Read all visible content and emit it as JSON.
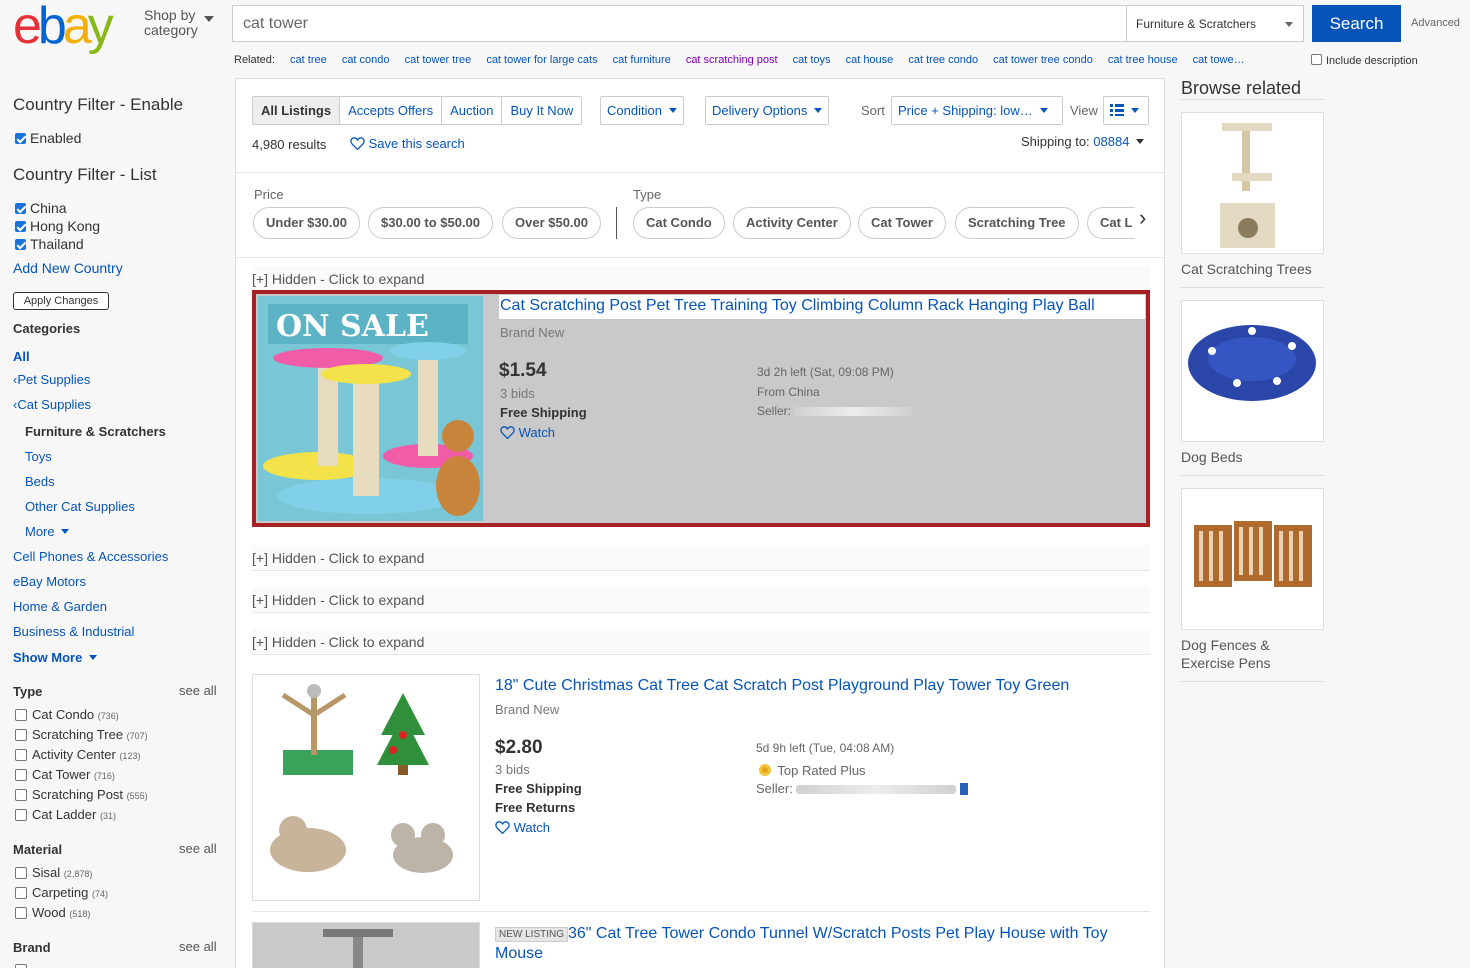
{
  "header": {
    "shop_by": "Shop by",
    "category": "category",
    "query": "cat tower",
    "category_select": "Furniture & Scratchers",
    "search_label": "Search",
    "advanced": "Advanced"
  },
  "related": {
    "label": "Related:",
    "items": [
      {
        "pre": "cat ",
        "bold": "tree"
      },
      {
        "pre": "cat ",
        "bold": "condo"
      },
      {
        "pre": "cat tower ",
        "bold": "tree"
      },
      {
        "pre": "cat tower ",
        "bold": "for large cats"
      },
      {
        "pre": "cat ",
        "bold": "furniture"
      },
      {
        "pre": "cat ",
        "bold": "scratching post"
      },
      {
        "pre": "cat ",
        "bold": "toys"
      },
      {
        "pre": "cat ",
        "bold": "house"
      },
      {
        "pre": "cat ",
        "bold": "tree condo"
      },
      {
        "pre": "cat tower ",
        "bold": "tree condo"
      },
      {
        "pre": "cat ",
        "bold": "tree house"
      },
      {
        "pre": "cat towe",
        "bold": "…"
      }
    ],
    "include_description": "Include description"
  },
  "left": {
    "country_enable_title": "Country Filter - Enable",
    "enabled": "Enabled",
    "country_list_title": "Country Filter - List",
    "countries": [
      "China",
      "Hong Kong",
      "Thailand"
    ],
    "add_country": "Add New Country",
    "apply_changes": "Apply Changes",
    "categories_title": "Categories",
    "all": "All",
    "pet_supplies": "Pet Supplies",
    "cat_supplies": "Cat Supplies",
    "furniture": "Furniture & Scratchers",
    "toys": "Toys",
    "beds": "Beds",
    "other_cat": "Other Cat Supplies",
    "more": "More",
    "cell_phones": "Cell Phones & Accessories",
    "ebay_motors": "eBay Motors",
    "home_garden": "Home & Garden",
    "business": "Business & Industrial",
    "show_more": "Show More",
    "type_title": "Type",
    "see_all": "see all",
    "types": [
      {
        "name": "Cat Condo",
        "count": "(736)"
      },
      {
        "name": "Scratching Tree",
        "count": "(707)"
      },
      {
        "name": "Activity Center",
        "count": "(123)"
      },
      {
        "name": "Cat Tower",
        "count": "(716)"
      },
      {
        "name": "Scratching Post",
        "count": "(555)"
      },
      {
        "name": "Cat Ladder",
        "count": "(31)"
      }
    ],
    "material_title": "Material",
    "materials": [
      {
        "name": "Sisal",
        "count": "(2,878)"
      },
      {
        "name": "Carpeting",
        "count": "(74)"
      },
      {
        "name": "Wood",
        "count": "(518)"
      }
    ],
    "brand_title": "Brand"
  },
  "main": {
    "tabs": [
      "All Listings",
      "Accepts Offers",
      "Auction",
      "Buy It Now"
    ],
    "condition": "Condition",
    "delivery": "Delivery Options",
    "sort_label": "Sort",
    "sort_value": "Price + Shipping: low…",
    "view_label": "View",
    "results": "4,980 results",
    "save_search": "Save this search",
    "shipping_to": "Shipping to:",
    "zip": "08884",
    "price_label": "Price",
    "price_pills": [
      "Under $30.00",
      "$30.00 to $50.00",
      "Over $50.00"
    ],
    "type_label": "Type",
    "type_pills": [
      "Cat Condo",
      "Activity Center",
      "Cat Tower",
      "Scratching Tree",
      "Cat L"
    ],
    "hidden": "[+] Hidden - Click to expand",
    "item1": {
      "badge": "ON SALE",
      "title": "Cat Scratching Post Pet Tree Training Toy Climbing Column Rack Hanging Play Ball",
      "condition": "Brand New",
      "price": "$1.54",
      "bids": "3 bids",
      "shipping": "Free Shipping",
      "watch": "Watch",
      "time_left": "3d 2h left (Sat, 09:08 PM)",
      "from": "From China",
      "seller": "Seller:"
    },
    "item2": {
      "title": "18\" Cute Christmas Cat Tree Cat Scratch Post Playground Play Tower Toy Green",
      "condition": "Brand New",
      "price": "$2.80",
      "bids": "3 bids",
      "shipping": "Free Shipping",
      "returns": "Free Returns",
      "watch": "Watch",
      "time_left": "5d 9h left (Tue, 04:08 AM)",
      "top_rated": "Top Rated Plus",
      "seller": "Seller:"
    },
    "item3": {
      "badge": "NEW LISTING",
      "title_line1": "36\" Cat Tree Tower Condo Tunnel W/Scratch Posts Pet Play House with Toy",
      "title_line2": "Mouse"
    }
  },
  "right": {
    "title": "Browse related",
    "items": [
      "Cat Scratching Trees",
      "Dog Beds",
      "Dog Fences &",
      "Exercise Pens"
    ]
  }
}
